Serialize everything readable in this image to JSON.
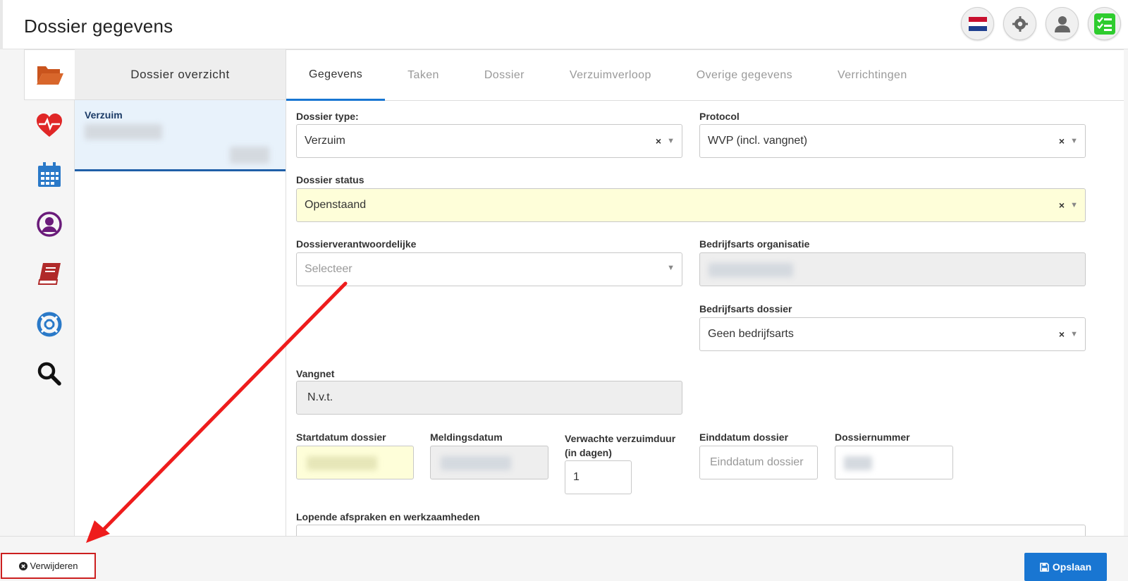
{
  "header": {
    "title": "Dossier gegevens"
  },
  "top_icons": [
    "dutch-flag-icon",
    "gear-icon",
    "user-icon",
    "checklist-icon"
  ],
  "rail": [
    "folder-open-icon",
    "heartbeat-icon",
    "calendar-icon",
    "user-circle-icon",
    "book-icon",
    "lifebuoy-icon",
    "search-icon"
  ],
  "overview": {
    "heading": "Dossier overzicht",
    "card_title": "Verzuim"
  },
  "tabs": [
    "Gegevens",
    "Taken",
    "Dossier",
    "Verzuimverloop",
    "Overige gegevens",
    "Verrichtingen"
  ],
  "form": {
    "dossier_type": {
      "label": "Dossier type:",
      "value": "Verzuim"
    },
    "protocol": {
      "label": "Protocol",
      "value": "WVP (incl. vangnet)"
    },
    "dossier_status": {
      "label": "Dossier status",
      "value": "Openstaand"
    },
    "verantwoordelijke": {
      "label": "Dossierverantwoordelijke",
      "placeholder": "Selecteer"
    },
    "bedrijfsarts_org": {
      "label": "Bedrijfsarts organisatie"
    },
    "bedrijfsarts_dossier": {
      "label": "Bedrijfsarts dossier",
      "value": "Geen bedrijfsarts"
    },
    "vangnet": {
      "label": "Vangnet",
      "value": "N.v.t."
    },
    "startdatum": {
      "label": "Startdatum dossier"
    },
    "meldingsdatum": {
      "label": "Meldingsdatum"
    },
    "verzuimduur": {
      "label_line1": "Verwachte verzuimduur",
      "label_line2": "(in dagen)",
      "value": "1"
    },
    "einddatum": {
      "label": "Einddatum dossier",
      "placeholder": "Einddatum dossier"
    },
    "dossiernummer": {
      "label": "Dossiernummer"
    },
    "lopende": {
      "label": "Lopende afspraken en werkzaamheden"
    },
    "clear_symbol": "×",
    "caret_symbol": "▼"
  },
  "footer": {
    "delete_label": "Verwijderen",
    "save_label": "Opslaan"
  },
  "colors": {
    "accent": "#1976d2",
    "danger": "#cc1f1f",
    "highlight_yellow": "#fefed9"
  }
}
